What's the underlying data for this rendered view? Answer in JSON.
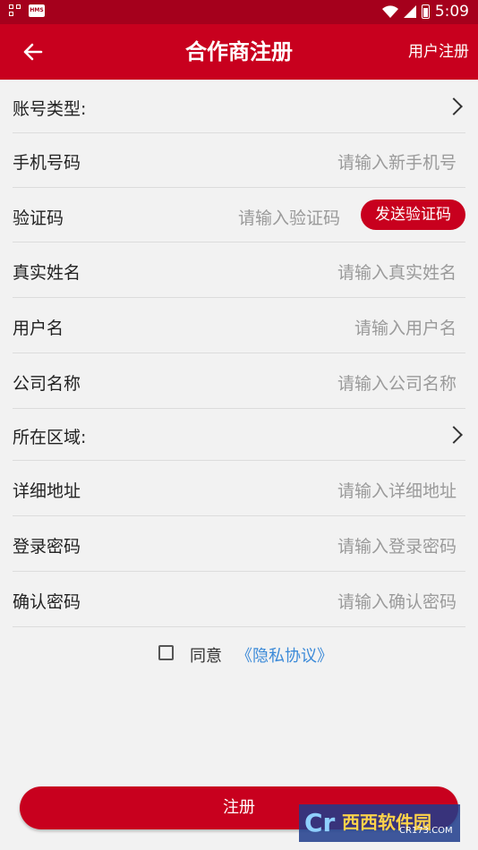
{
  "status_bar": {
    "time": "5:09",
    "badge": "HMS"
  },
  "header": {
    "title": "合作商注册",
    "right_link": "用户注册"
  },
  "form": {
    "account_type": {
      "label": "账号类型:"
    },
    "phone": {
      "label": "手机号码",
      "placeholder": "请输入新手机号"
    },
    "code": {
      "label": "验证码",
      "placeholder": "请输入验证码",
      "button": "发送验证码"
    },
    "real_name": {
      "label": "真实姓名",
      "placeholder": "请输入真实姓名"
    },
    "username": {
      "label": "用户名",
      "placeholder": "请输入用户名"
    },
    "company": {
      "label": "公司名称",
      "placeholder": "请输入公司名称"
    },
    "region": {
      "label": "所在区域:"
    },
    "address": {
      "label": "详细地址",
      "placeholder": "请输入详细地址"
    },
    "password": {
      "label": "登录密码",
      "placeholder": "请输入登录密码"
    },
    "confirm_password": {
      "label": "确认密码",
      "placeholder": "请输入确认密码"
    }
  },
  "agreement": {
    "text": "同意",
    "link": "《隐私协议》",
    "checked": false
  },
  "submit_label": "注册",
  "watermark": {
    "logo": "Cr",
    "name": "西西软件园",
    "site": "CR173.COM"
  },
  "colors": {
    "primary": "#c8001e",
    "status_bar": "#a5001c",
    "link": "#3c8ad8",
    "background": "#f2f2f2"
  },
  "icons": [
    "back-arrow-icon",
    "chevron-right-icon",
    "wifi-icon",
    "signal-icon",
    "battery-icon",
    "checkbox-icon"
  ]
}
